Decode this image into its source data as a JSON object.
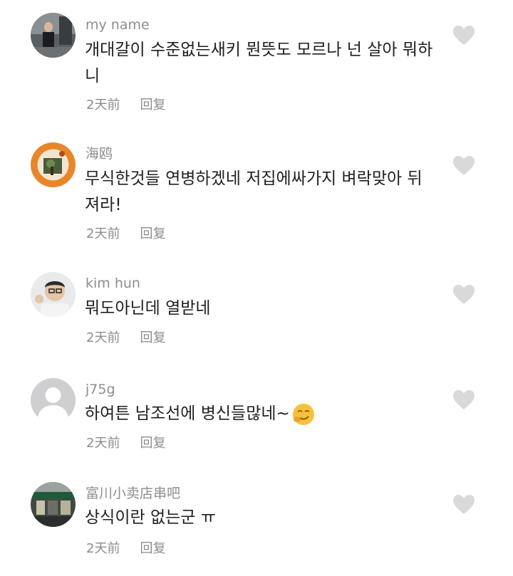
{
  "comments": [
    {
      "username": "my name",
      "text": "개대갈이 수준없는새키  뭔뜻도 모르나 넌 살아 뭐하니",
      "time": "2天前",
      "reply": "回复"
    },
    {
      "username": "海鸥",
      "text": "무식한것들 연병하겠네 저집에싸가지 벼락맞아 뒤져라!",
      "time": "2天前",
      "reply": "回复"
    },
    {
      "username": "kim hun",
      "text": "뭐도아닌데 열받네",
      "time": "2天前",
      "reply": "回复"
    },
    {
      "username": "j75g",
      "text": "하여튼 남조선에 병신들많네~",
      "time": "2天前",
      "reply": "回复"
    },
    {
      "username": "富川小卖店串吧",
      "text": "상식이란 없는군 ㅠ",
      "time": "2天前",
      "reply": "回复"
    }
  ],
  "icons": {
    "like": "heart-icon",
    "emoji": "smirk-emoji-icon",
    "default_avatar": "default-avatar-icon"
  },
  "colors": {
    "heart": "#d9d9d9",
    "username": "#8e8e8e",
    "text": "#1f1f1f",
    "meta": "#8c8c8c"
  }
}
